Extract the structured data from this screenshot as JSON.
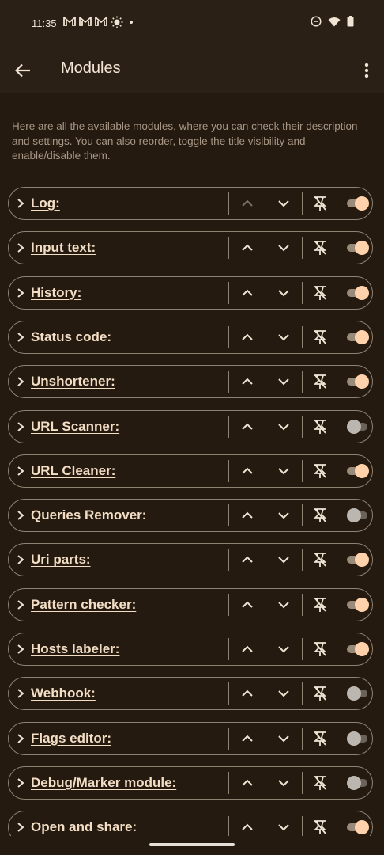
{
  "status": {
    "time": "11:35",
    "left_icons": [
      "gmail-icon",
      "gmail-icon",
      "gmail-icon",
      "brightness-icon",
      "dot-icon"
    ],
    "right_icons": [
      "dnd-icon",
      "wifi-icon",
      "battery-icon"
    ]
  },
  "appbar": {
    "title": "Modules"
  },
  "description": "Here are all the available modules, where you can check their description and settings. You can also reorder, toggle the title visibility and enable/disable them.",
  "colors": {
    "background": "#241a0f",
    "accent": "#ffd2ab",
    "outline": "#8f8273"
  },
  "modules": [
    {
      "label": "Log:",
      "enabled": true
    },
    {
      "label": "Input text:",
      "enabled": true
    },
    {
      "label": "History:",
      "enabled": true
    },
    {
      "label": "Status code:",
      "enabled": true
    },
    {
      "label": "Unshortener:",
      "enabled": true
    },
    {
      "label": "URL Scanner:",
      "enabled": false
    },
    {
      "label": "URL Cleaner:",
      "enabled": true
    },
    {
      "label": "Queries Remover:",
      "enabled": false
    },
    {
      "label": "Uri parts:",
      "enabled": true
    },
    {
      "label": "Pattern checker:",
      "enabled": true
    },
    {
      "label": "Hosts labeler:",
      "enabled": true
    },
    {
      "label": "Webhook:",
      "enabled": false
    },
    {
      "label": "Flags editor:",
      "enabled": false
    },
    {
      "label": "Debug/Marker module:",
      "enabled": false
    },
    {
      "label": "Open and share:",
      "enabled": true
    }
  ]
}
